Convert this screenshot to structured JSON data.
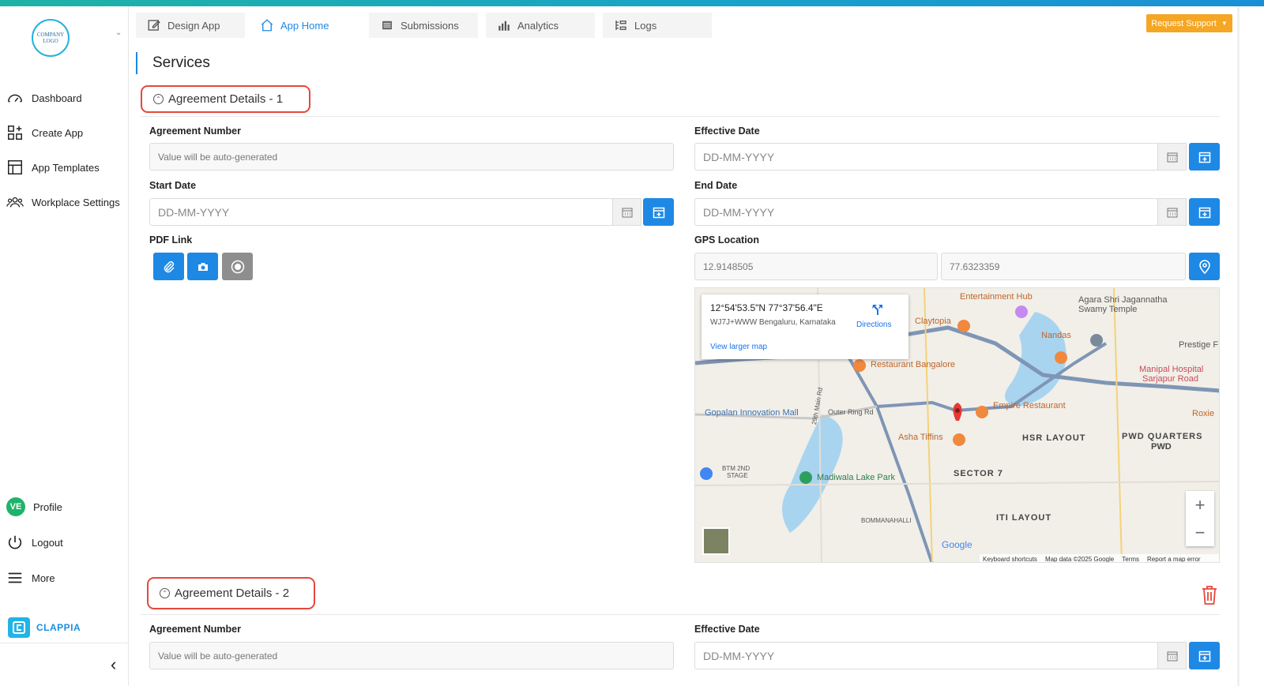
{
  "sidebar": {
    "logo_text": "COMPANY LOGO",
    "nav": [
      {
        "label": "Dashboard",
        "icon": "gauge-icon"
      },
      {
        "label": "Create App",
        "icon": "grid-plus-icon"
      },
      {
        "label": "App Templates",
        "icon": "template-icon"
      },
      {
        "label": "Workplace Settings",
        "icon": "users-icon"
      }
    ],
    "profile": {
      "initials": "VE",
      "label": "Profile"
    },
    "logout": "Logout",
    "more": "More",
    "brand": "CLAPPIA"
  },
  "tabs": [
    {
      "label": "Design App",
      "icon": "edit-icon",
      "active": false
    },
    {
      "label": "App Home",
      "icon": "home-icon",
      "active": true
    },
    {
      "label": "Submissions",
      "icon": "list-icon",
      "active": false
    },
    {
      "label": "Analytics",
      "icon": "bar-chart-icon",
      "active": false
    },
    {
      "label": "Logs",
      "icon": "logs-icon",
      "active": false
    }
  ],
  "request_support": "Request Support",
  "page_title": "Services",
  "section1": {
    "title": "Agreement Details - 1",
    "agreement_number_label": "Agreement Number",
    "agreement_number_placeholder": "Value will be auto-generated",
    "effective_date_label": "Effective Date",
    "start_date_label": "Start Date",
    "end_date_label": "End Date",
    "date_placeholder": "DD-MM-YYYY",
    "pdf_link_label": "PDF Link",
    "gps_label": "GPS Location",
    "latitude": "12.9148505",
    "longitude": "77.6323359"
  },
  "map": {
    "coords": "12°54'53.5\"N 77°37'56.4\"E",
    "address": "WJ7J+WWW Bengaluru, Karnataka",
    "directions": "Directions",
    "larger_map": "View larger map",
    "places": [
      "Entertainment Hub",
      "Agara Shri Jagannatha",
      "Swamy Temple",
      "Claytopia",
      "Nandas",
      "Prestige F",
      "Restaurant Bangalore",
      "Manipal Hospital",
      "Sarjapur Road",
      "Gopalan Innovation Mall",
      "Outer Ring Rd",
      "Empire Restaurant",
      "HSR LAYOUT",
      "Roxie",
      "Asha Tiffins",
      "PWD QUARTERS",
      "PWD",
      "BTM 2ND",
      "STAGE",
      "SECTOR 7",
      "Madiwala Lake Park",
      "29th Main Rd",
      "ITI LAYOUT",
      "BOMMANAHALLI",
      "Google"
    ],
    "footer": [
      "Keyboard shortcuts",
      "Map data ©2025 Google",
      "Terms",
      "Report a map error"
    ]
  },
  "section2": {
    "title": "Agreement Details - 2",
    "agreement_number_label": "Agreement Number",
    "agreement_number_placeholder": "Value will be auto-generated",
    "effective_date_label": "Effective Date",
    "date_placeholder": "DD-MM-YYYY"
  },
  "colors": {
    "primary": "#1e88e5",
    "support": "#f5a623",
    "highlight": "#e5483b",
    "danger": "#e5483b"
  }
}
